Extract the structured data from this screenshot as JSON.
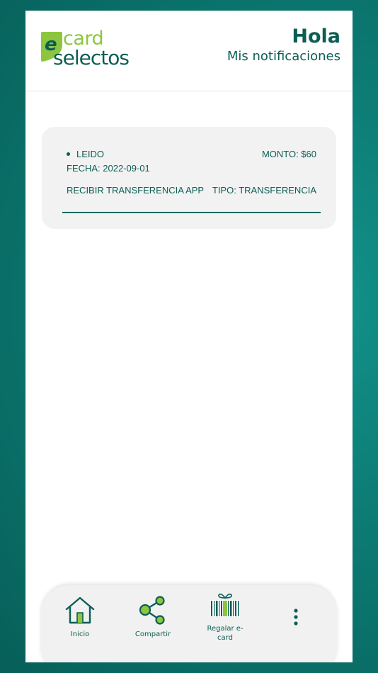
{
  "header": {
    "logo": {
      "prefix": "e",
      "card": "card",
      "selectos": "selectos"
    },
    "greeting": "Hola",
    "subtitle": "Mis notificaciones"
  },
  "notifications": [
    {
      "status": "LEIDO",
      "amount": "MONTO: $60",
      "date": "FECHA: 2022-09-01",
      "description": "RECIBIR TRANSFERENCIA APP",
      "type": "TIPO: TRANSFERENCIA"
    }
  ],
  "nav": {
    "home": {
      "label": "Inicio",
      "icon": "home-icon"
    },
    "share": {
      "label": "Compartir",
      "icon": "share-icon"
    },
    "gift": {
      "label_line1": "Regalar e-",
      "label_line2": "card",
      "icon": "gift-barcode-icon"
    },
    "more": {
      "icon": "more-vertical-icon"
    }
  },
  "colors": {
    "brand_dark": "#0b5e54",
    "brand_green": "#8cc63f",
    "background": "#0c7a73"
  }
}
